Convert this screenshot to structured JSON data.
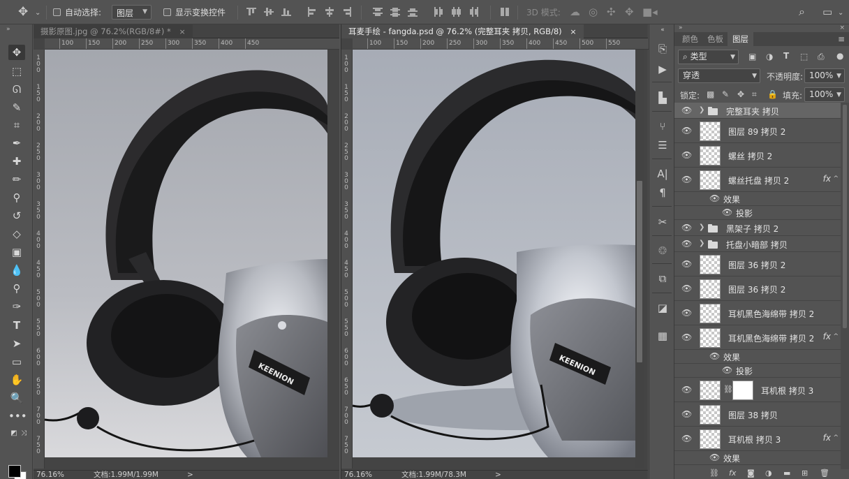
{
  "options_bar": {
    "auto_select_label": "自动选择:",
    "auto_select_value": "图层",
    "show_transform_label": "显示变换控件",
    "mode_3d_label": "3D 模式:"
  },
  "doc1": {
    "tab_title": "摄影原图.jpg @ 76.2%(RGB/8#) *",
    "close": "×",
    "ruler_ticks": [
      "100",
      "150",
      "200",
      "250",
      "300",
      "350",
      "400",
      "450"
    ],
    "vruler_ticks": [
      "100",
      "150",
      "200",
      "250",
      "300",
      "350",
      "400",
      "450",
      "500",
      "550",
      "600",
      "650",
      "700",
      "750"
    ],
    "zoom": "76.16%",
    "doc_info": "文档:1.99M/1.99M",
    "arrow": ">"
  },
  "doc2": {
    "tab_title": "耳麦手绘 - fangda.psd @ 76.2% (完整耳夹 拷贝, RGB/8)",
    "close": "×",
    "ruler_ticks": [
      "100",
      "150",
      "200",
      "250",
      "300",
      "350",
      "400",
      "450",
      "500",
      "550"
    ],
    "vruler_ticks": [
      "100",
      "150",
      "200",
      "250",
      "300",
      "350",
      "400",
      "450",
      "500",
      "550",
      "600",
      "650",
      "700",
      "750"
    ],
    "zoom": "76.16%",
    "doc_info": "文档:1.99M/78.3M",
    "arrow": ">"
  },
  "product_logo": "KEENION",
  "layers_panel": {
    "tabs": [
      "颜色",
      "色板",
      "图层"
    ],
    "active_tab": "图层",
    "filter_kind": "类型",
    "blend_mode": "穿透",
    "opacity_label": "不透明度:",
    "opacity_value": "100%",
    "lock_label": "锁定:",
    "fill_label": "填充:",
    "fill_value": "100%",
    "layers": [
      {
        "name": "完整耳夹 拷贝",
        "type": "group",
        "selected": true
      },
      {
        "name": "图层 89 拷贝 2",
        "type": "layer"
      },
      {
        "name": "螺丝 拷贝 2",
        "type": "layer"
      },
      {
        "name": "螺丝托盘 拷贝 2",
        "type": "layer",
        "fx": true
      },
      {
        "name": "效果",
        "type": "effects"
      },
      {
        "name": "投影",
        "type": "effect"
      },
      {
        "name": "黑架子 拷贝 2",
        "type": "group"
      },
      {
        "name": "托盘小暗部 拷贝",
        "type": "group"
      },
      {
        "name": "图层 36 拷贝 2",
        "type": "layer"
      },
      {
        "name": "图层 36 拷贝 2",
        "type": "layer"
      },
      {
        "name": "耳机黑色海绵带 拷贝 2",
        "type": "layer"
      },
      {
        "name": "耳机黑色海绵带 拷贝 2",
        "type": "layer",
        "fx": true
      },
      {
        "name": "效果",
        "type": "effects"
      },
      {
        "name": "投影",
        "type": "effect"
      },
      {
        "name": "耳机根 拷贝 3",
        "type": "masked"
      },
      {
        "name": "图层 38 拷贝",
        "type": "layer"
      },
      {
        "name": "耳机根 拷贝 3",
        "type": "layer",
        "fx": true
      },
      {
        "name": "效果",
        "type": "effects"
      }
    ],
    "fx_label": "fx"
  }
}
